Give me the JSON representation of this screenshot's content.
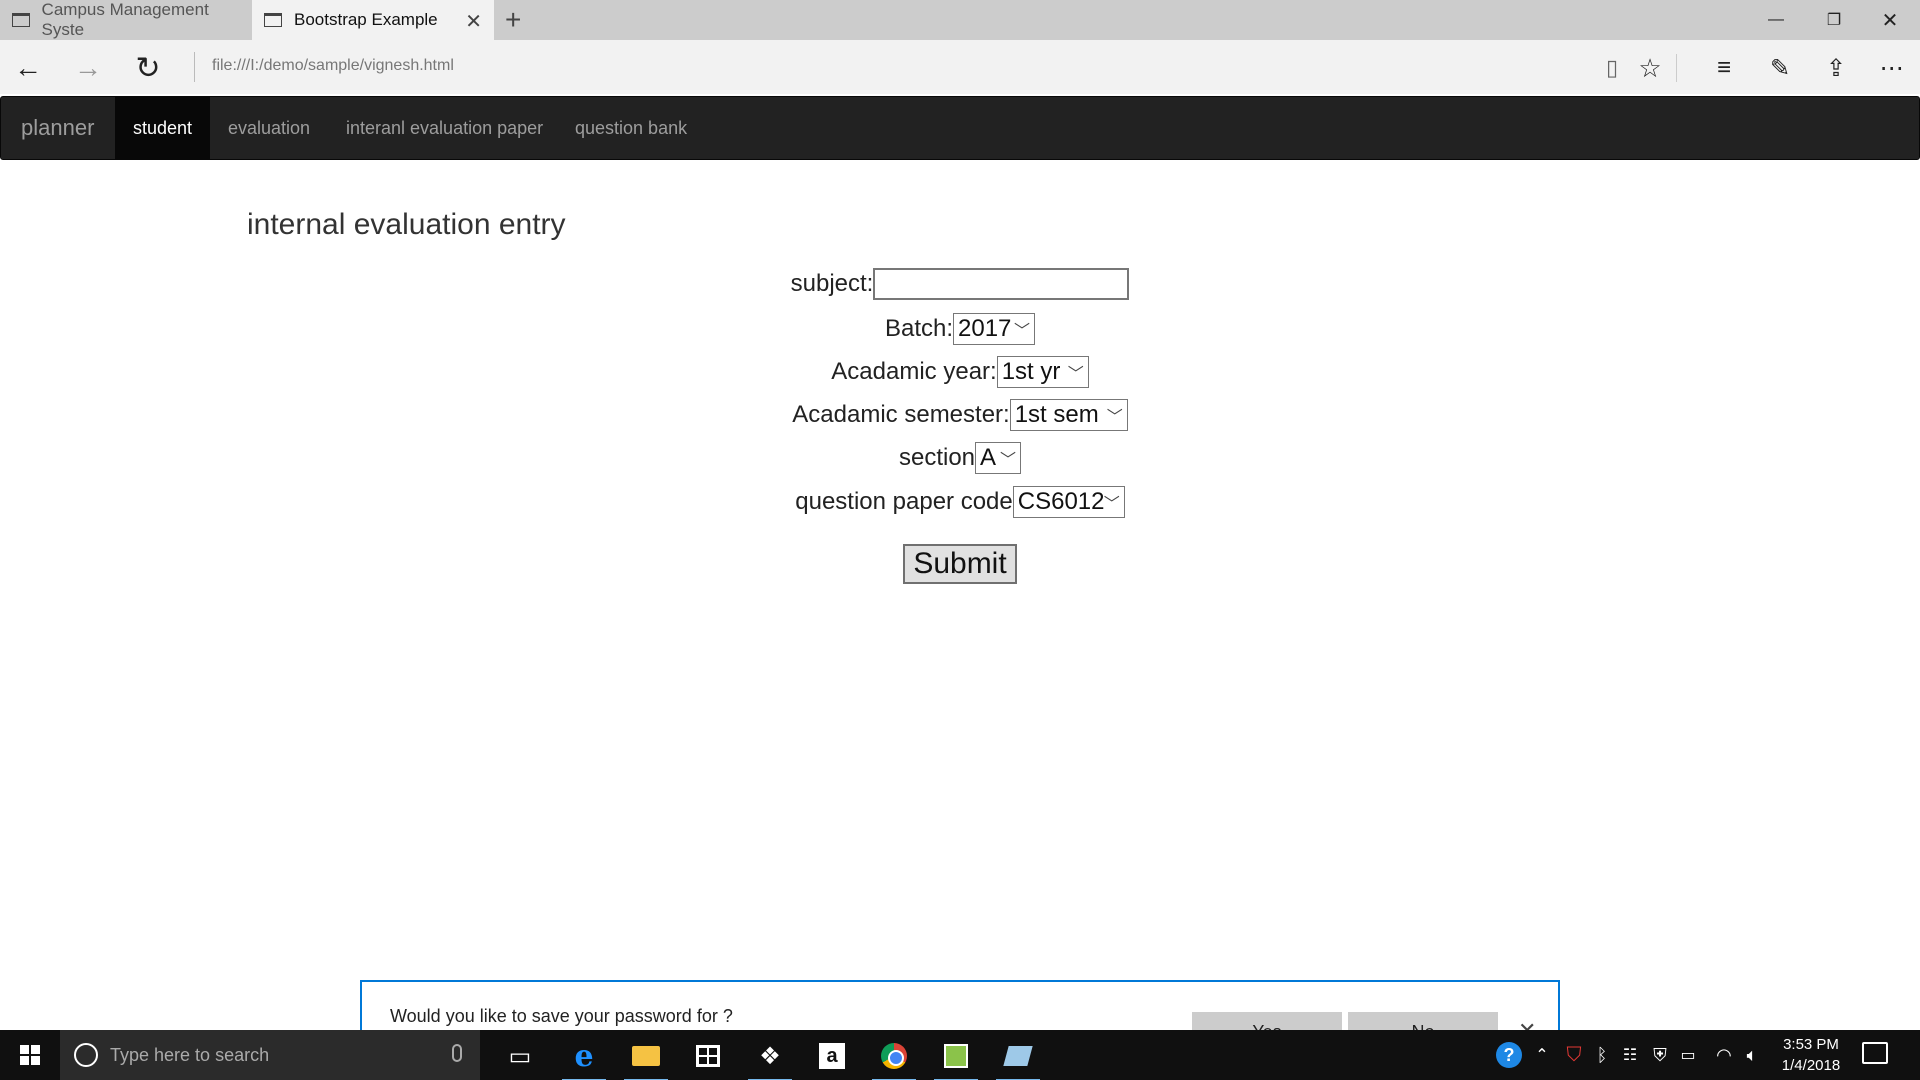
{
  "browser": {
    "tabs": [
      {
        "label": "Campus Management Syste",
        "active": false
      },
      {
        "label": "Bootstrap Example",
        "active": true
      }
    ],
    "url": "file:///I:/demo/sample/vignesh.html",
    "window_controls": {
      "minimize": "—",
      "restore": "❐",
      "close": "✕"
    }
  },
  "navbar": {
    "brand": "planner",
    "items": [
      {
        "label": "student",
        "active": true
      },
      {
        "label": "evaluation",
        "active": false
      },
      {
        "label": "interanl evaluation paper",
        "active": false
      },
      {
        "label": "question bank",
        "active": false
      }
    ]
  },
  "page": {
    "heading": "internal evaluation entry",
    "form": {
      "subject_label": "subject:",
      "subject_value": "",
      "batch_label": "Batch:",
      "batch_value": "2017",
      "year_label": "Acadamic year:",
      "year_value": "1st yr",
      "semester_label": "Acadamic semester:",
      "semester_value": "1st sem",
      "section_label": "section",
      "section_value": "A",
      "qpcode_label": "question paper code",
      "qpcode_value": "CS6012",
      "submit_label": "Submit"
    }
  },
  "password_prompt": {
    "text": "Would you like to save your password for ?",
    "yes_label": "Yes",
    "no_label": "No"
  },
  "taskbar": {
    "search_placeholder": "Type here to search",
    "time": "3:53 PM",
    "date": "1/4/2018"
  },
  "colors": {
    "navbar_bg": "#222222",
    "navbar_active_bg": "#080808",
    "prompt_border": "#0078d7",
    "taskbar_bg": "#101010"
  }
}
